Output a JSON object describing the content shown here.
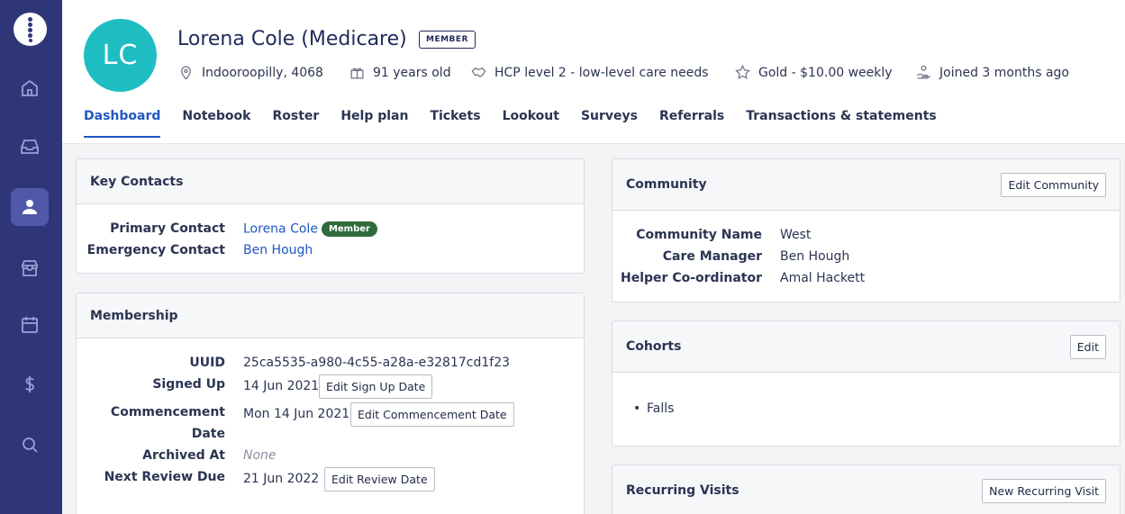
{
  "nav": {
    "items": [
      "home-icon",
      "inbox-icon",
      "user-icon",
      "store-icon",
      "calendar-icon",
      "dollar-icon",
      "search-icon"
    ],
    "active": "user-icon",
    "accent": "#2f3677"
  },
  "client": {
    "initials": "LC",
    "name": "Lorena Cole (Medicare)",
    "badge": "MEMBER",
    "location": "Indooroopilly, 4068",
    "age": "91 years old",
    "care_level": "HCP level 2 - low-level care needs",
    "plan": "Gold - $10.00 weekly",
    "joined": "Joined 3 months ago"
  },
  "tabs": [
    "Dashboard",
    "Notebook",
    "Roster",
    "Help plan",
    "Tickets",
    "Lookout",
    "Surveys",
    "Referrals",
    "Transactions & statements"
  ],
  "key_contacts": {
    "title": "Key Contacts",
    "primary_label": "Primary Contact",
    "primary_value": "Lorena Cole",
    "primary_badge": "Member",
    "emergency_label": "Emergency Contact",
    "emergency_value": "Ben Hough"
  },
  "membership": {
    "title": "Membership",
    "uuid_label": "UUID",
    "uuid_value": "25ca5535-a980-4c55-a28a-e32817cd1f23",
    "signed_label": "Signed Up",
    "signed_value": "14 Jun 2021",
    "signed_btn": "Edit Sign Up Date",
    "commence_label_1": "Commencement",
    "commence_label_2": "Date",
    "commence_value": "Mon 14 Jun 2021",
    "commence_btn": "Edit Commencement Date",
    "archived_label": "Archived At",
    "archived_value": "None",
    "review_label": "Next Review Due",
    "review_value": "21 Jun 2022",
    "review_btn": "Edit Review Date"
  },
  "community": {
    "title": "Community",
    "edit_btn": "Edit Community",
    "name_label": "Community Name",
    "name_value": "West",
    "manager_label": "Care Manager",
    "manager_value": "Ben Hough",
    "helper_label": "Helper Co-ordinator",
    "helper_value": "Amal Hackett"
  },
  "cohorts": {
    "title": "Cohorts",
    "edit_btn": "Edit",
    "items": [
      "Falls"
    ]
  },
  "recurring": {
    "title": "Recurring Visits",
    "new_btn": "New Recurring Visit"
  }
}
